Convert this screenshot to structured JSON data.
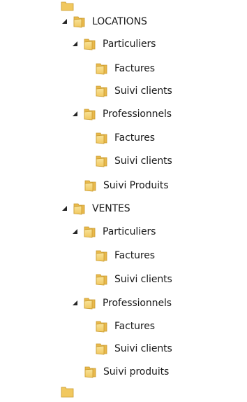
{
  "window": {
    "title": ""
  },
  "tree": [
    {
      "label": "LOCATIONS",
      "expanded": true,
      "level": 0
    },
    {
      "label": "Particuliers",
      "expanded": true,
      "level": 1
    },
    {
      "label": "Factures",
      "expanded": false,
      "level": 2
    },
    {
      "label": "Suivi clients",
      "expanded": false,
      "level": 2
    },
    {
      "label": "Professionnels",
      "expanded": true,
      "level": 1
    },
    {
      "label": "Factures",
      "expanded": false,
      "level": 2
    },
    {
      "label": "Suivi clients",
      "expanded": false,
      "level": 2
    },
    {
      "label": "Suivi Produits",
      "expanded": false,
      "level": 1
    },
    {
      "label": "VENTES",
      "expanded": true,
      "level": 0
    },
    {
      "label": "Particuliers",
      "expanded": true,
      "level": 1
    },
    {
      "label": "Factures",
      "expanded": false,
      "level": 2
    },
    {
      "label": "Suivi clients",
      "expanded": false,
      "level": 2
    },
    {
      "label": "Professionnels",
      "expanded": true,
      "level": 1
    },
    {
      "label": "Factures",
      "expanded": false,
      "level": 2
    },
    {
      "label": "Suivi clients",
      "expanded": false,
      "level": 2
    },
    {
      "label": "Suivi produits",
      "expanded": false,
      "level": 1
    }
  ],
  "icons": {
    "folder": "folder-icon",
    "expanded": "expanded-arrow-icon"
  },
  "colors": {
    "folder_body": "#f1c85f",
    "folder_highlight": "#f8e39a",
    "folder_shadow": "#c99a2c",
    "arrow": "#262626",
    "text": "#1a1a1a",
    "background": "#ffffff"
  }
}
